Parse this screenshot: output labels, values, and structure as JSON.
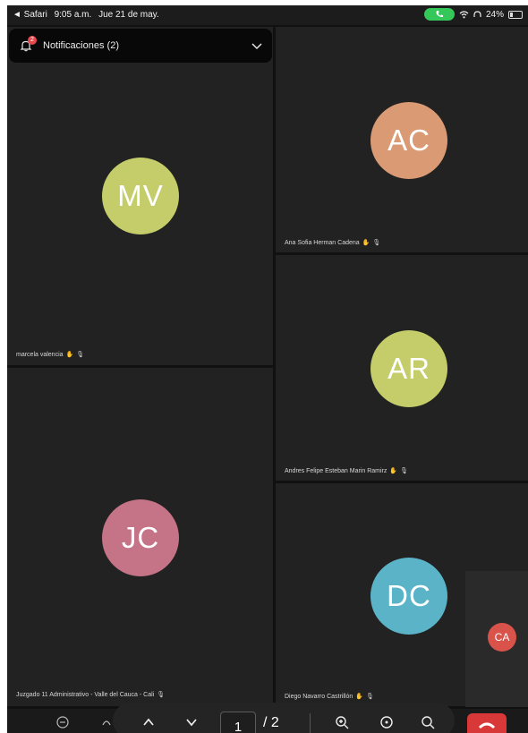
{
  "status_bar": {
    "back_app": "◄ Safari",
    "time": "9:05 a.m.",
    "date": "Jue 21 de may.",
    "battery": "24%"
  },
  "notifications": {
    "label": "Notificaciones (2)",
    "badge": "2"
  },
  "participants": [
    {
      "initials": "MV",
      "name": "marcela valencia",
      "color": "#c4cd6a"
    },
    {
      "initials": "AC",
      "name": "Ana Sofia Herman Cadena",
      "color": "#d99a74"
    },
    {
      "initials": "AR",
      "name": "Andres Felipe Esteban Marin Ramirz",
      "color": "#c4cd6a"
    },
    {
      "initials": "JC",
      "name": "Juzgado 11 Administrativo - Valle del Cauca - Cali",
      "color": "#c57386"
    },
    {
      "initials": "DC",
      "name": "Diego Navarro Castrillón",
      "color": "#5bb3c8"
    }
  ],
  "self_view": {
    "initials": "CA",
    "color": "#d9534a"
  },
  "pdf_toolbar": {
    "current_page": "1",
    "total_pages": "/ 2"
  },
  "leave_color": "#d93838"
}
